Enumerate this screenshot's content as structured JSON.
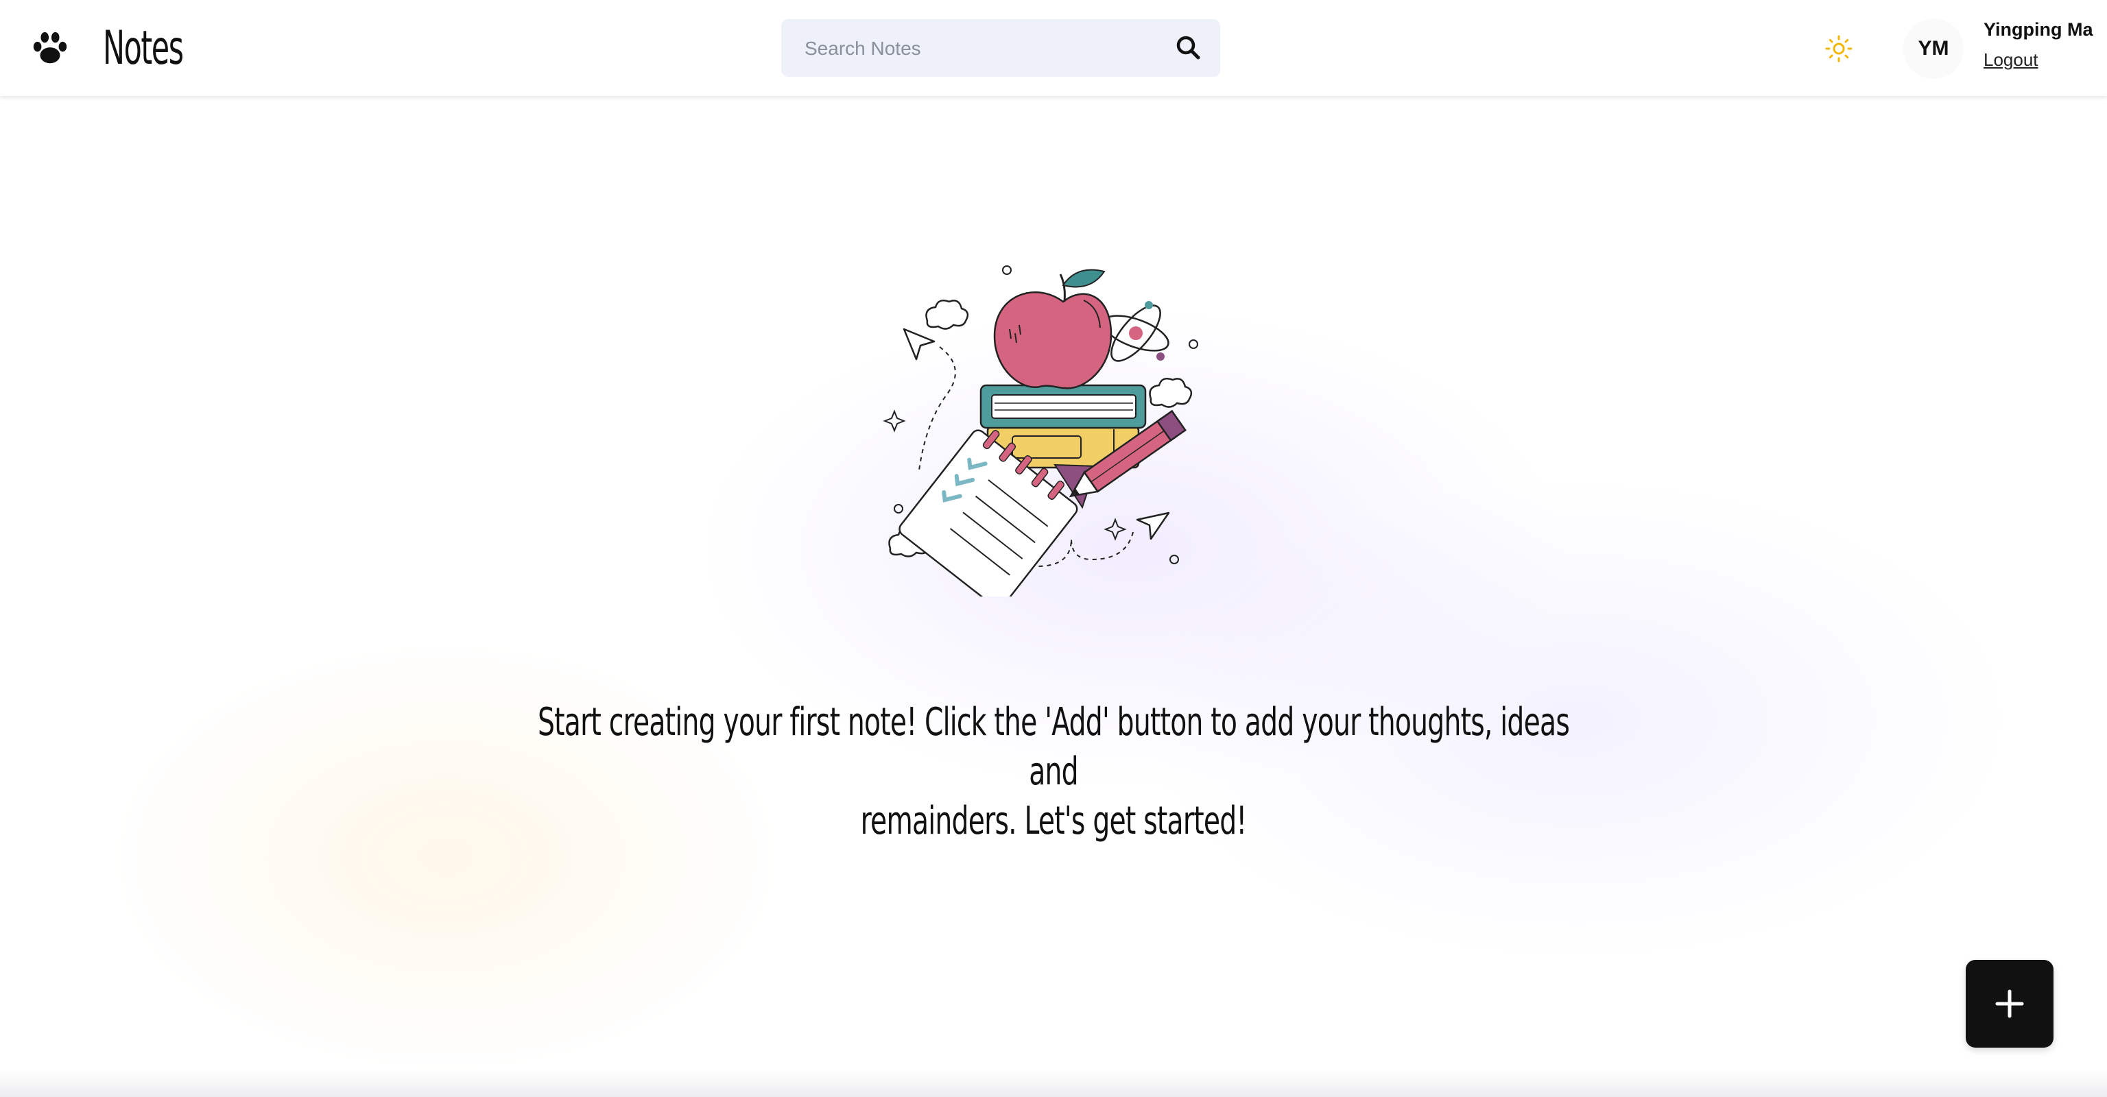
{
  "header": {
    "logo_icon": "paw-icon",
    "title": "Notes",
    "search": {
      "placeholder": "Search Notes",
      "value": "",
      "icon": "search-icon"
    },
    "theme_icon": "sun-icon",
    "theme_color": "#f2b705",
    "user": {
      "initials": "YM",
      "name": "Yingping Ma",
      "logout_label": "Logout"
    }
  },
  "main": {
    "illustration": "books-apple-notebook-pencil-illustration",
    "empty_message_line1": "Start creating your first note! Click the 'Add' button to add your thoughts, ideas and",
    "empty_message_line2": "remainders. Let's get started!"
  },
  "fab": {
    "icon": "plus-icon",
    "color": "#111111"
  },
  "colors": {
    "apple": "#d4647f",
    "leaf": "#3f8f8f",
    "book_teal": "#4f9c9c",
    "book_yellow": "#f2cf66",
    "pencil": "#d4647f",
    "accent_purple": "#8c4f7f"
  }
}
